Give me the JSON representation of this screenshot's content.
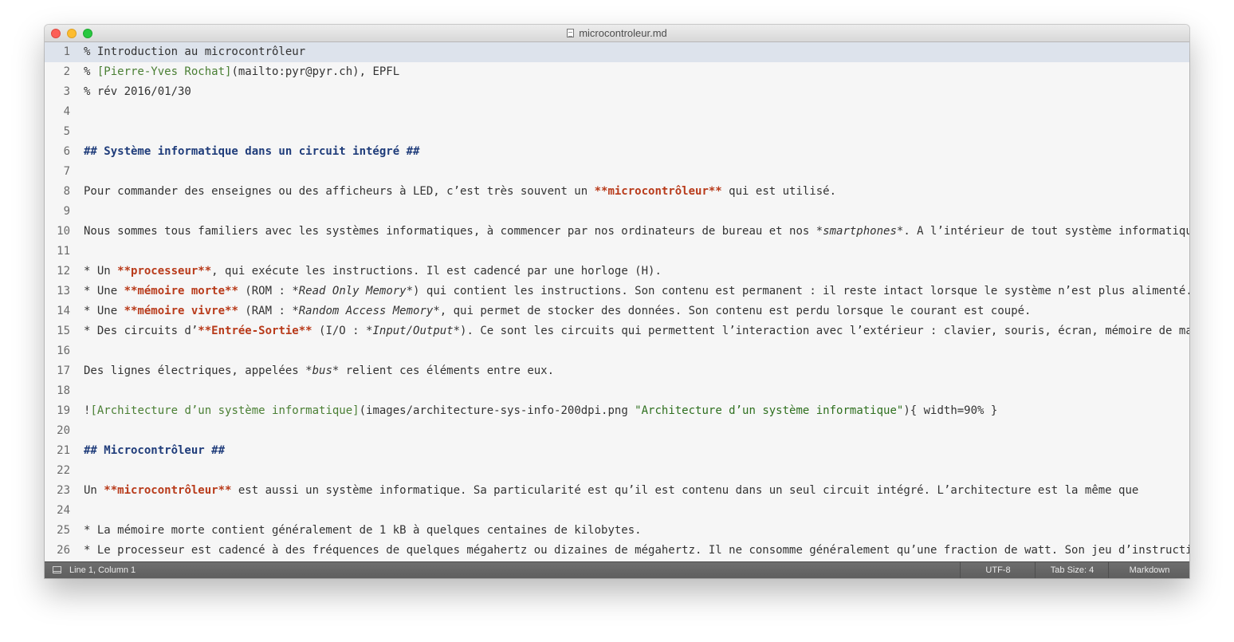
{
  "window": {
    "title": "microcontroleur.md"
  },
  "editor": {
    "lines": [
      {
        "n": "1",
        "segs": [
          {
            "t": "% Introduction au microcontrôleur"
          }
        ]
      },
      {
        "n": "2",
        "segs": [
          {
            "t": "% "
          },
          {
            "t": "[Pierre-Yves Rochat]",
            "c": "linktext"
          },
          {
            "t": "(mailto:pyr@pyr.ch), EPFL"
          }
        ]
      },
      {
        "n": "3",
        "segs": [
          {
            "t": "% rév 2016/01/30"
          }
        ]
      },
      {
        "n": "4",
        "segs": []
      },
      {
        "n": "5",
        "segs": []
      },
      {
        "n": "6",
        "segs": [
          {
            "t": "## Système informatique dans un circuit intégré ##",
            "c": "heading"
          }
        ]
      },
      {
        "n": "7",
        "segs": []
      },
      {
        "n": "8",
        "segs": [
          {
            "t": "Pour commander des enseignes ou des afficheurs à LED, c’est très souvent un "
          },
          {
            "t": "**microcontrôleur**",
            "c": "strong"
          },
          {
            "t": " qui est utilisé."
          }
        ]
      },
      {
        "n": "9",
        "segs": []
      },
      {
        "n": "10",
        "segs": [
          {
            "t": "Nous sommes tous familiers avec les systèmes informatiques, à commencer par nos ordinateurs de bureau et nos "
          },
          {
            "t": "*smartphones*",
            "c": "em"
          },
          {
            "t": ". A l’intérieur de tout système informatique"
          }
        ]
      },
      {
        "n": "11",
        "segs": []
      },
      {
        "n": "12",
        "segs": [
          {
            "t": "* Un "
          },
          {
            "t": "**processeur**",
            "c": "strong"
          },
          {
            "t": ", qui exécute les instructions. Il est cadencé par une horloge (H)."
          }
        ]
      },
      {
        "n": "13",
        "segs": [
          {
            "t": "* Une "
          },
          {
            "t": "**mémoire morte**",
            "c": "strong"
          },
          {
            "t": " (ROM : "
          },
          {
            "t": "*Read Only Memory*",
            "c": "em"
          },
          {
            "t": ") qui contient les instructions. Son contenu est permanent : il reste intact lorsque le système n’est plus alimenté."
          }
        ]
      },
      {
        "n": "14",
        "segs": [
          {
            "t": "* Une "
          },
          {
            "t": "**mémoire vivre**",
            "c": "strong"
          },
          {
            "t": " (RAM : "
          },
          {
            "t": "*Random Access Memory*",
            "c": "em"
          },
          {
            "t": ", qui permet de stocker des données. Son contenu est perdu lorsque le courant est coupé."
          }
        ]
      },
      {
        "n": "15",
        "segs": [
          {
            "t": "* Des circuits d’"
          },
          {
            "t": "**Entrée-Sortie**",
            "c": "strong"
          },
          {
            "t": " (I/O : "
          },
          {
            "t": "*Input/Output*",
            "c": "em"
          },
          {
            "t": "). Ce sont les circuits qui permettent l’interaction avec l’extérieur : clavier, souris, écran, mémoire de masse."
          }
        ]
      },
      {
        "n": "16",
        "segs": []
      },
      {
        "n": "17",
        "segs": [
          {
            "t": "Des lignes électriques, appelées "
          },
          {
            "t": "*bus*",
            "c": "em"
          },
          {
            "t": " relient ces éléments entre eux."
          }
        ]
      },
      {
        "n": "18",
        "segs": []
      },
      {
        "n": "19",
        "segs": [
          {
            "t": "!"
          },
          {
            "t": "[Architecture d’un système informatique]",
            "c": "linktext"
          },
          {
            "t": "(images/architecture-sys-info-200dpi.png "
          },
          {
            "t": "\"Architecture d’un système informatique\"",
            "c": "str"
          },
          {
            "t": "){ width=90% }"
          }
        ]
      },
      {
        "n": "20",
        "segs": []
      },
      {
        "n": "21",
        "segs": [
          {
            "t": "## Microcontrôleur ##",
            "c": "heading"
          }
        ]
      },
      {
        "n": "22",
        "segs": []
      },
      {
        "n": "23",
        "segs": [
          {
            "t": "Un "
          },
          {
            "t": "**microcontrôleur**",
            "c": "strong"
          },
          {
            "t": " est aussi un système informatique. Sa particularité est qu’il est contenu dans un seul circuit intégré. L’architecture est la même que"
          }
        ]
      },
      {
        "n": "24",
        "segs": []
      },
      {
        "n": "25",
        "segs": [
          {
            "t": "* La mémoire morte contient généralement de 1 kB à quelques centaines de kilobytes."
          }
        ]
      },
      {
        "n": "26",
        "segs": [
          {
            "t": "* Le processeur est cadencé à des fréquences de quelques mégahertz ou dizaines de mégahertz. Il ne consomme généralement qu’une fraction de watt. Son jeu d’instructions"
          }
        ]
      }
    ]
  },
  "statusbar": {
    "position": "Line 1, Column 1",
    "encoding": "UTF-8",
    "tab_size": "Tab Size: 4",
    "syntax": "Markdown"
  }
}
